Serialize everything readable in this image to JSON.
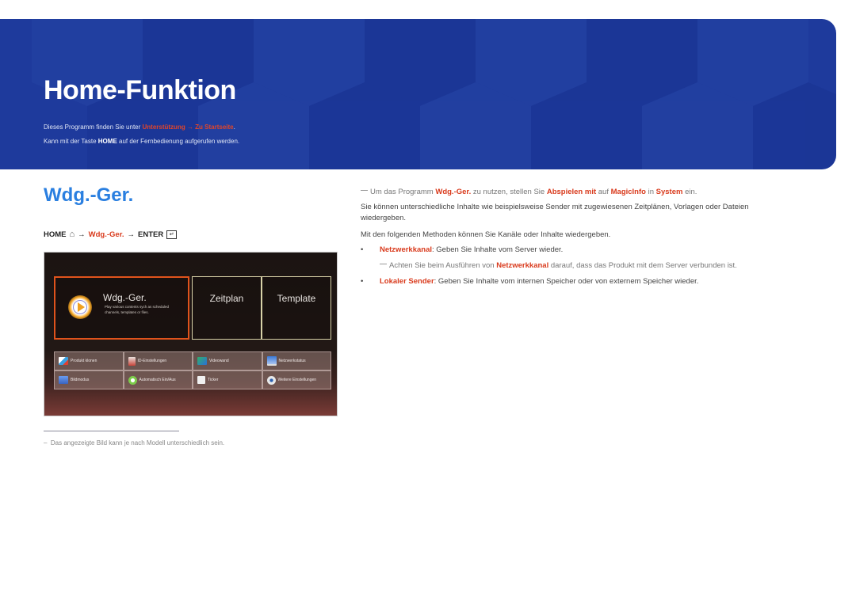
{
  "banner": {
    "title": "Home-Funktion",
    "line1_prefix": "Dieses Programm finden Sie unter ",
    "line1_path1": "Unterstützung",
    "line1_arrow": " → ",
    "line1_path2": "Zu Startseite",
    "line1_suffix": ".",
    "line2_prefix": "Kann mit der Taste ",
    "line2_key": "HOME",
    "line2_suffix": " auf der Fernbedienung aufgerufen werden.",
    "colors": {
      "background": "#1e3a9c",
      "highlight": "#e0452a"
    }
  },
  "section": {
    "title": "Wdg.-Ger.",
    "title_color": "#2a7fe0"
  },
  "nav_path": {
    "home": "HOME",
    "home_icon": "home-icon",
    "arrow1": "→",
    "item": "Wdg.-Ger.",
    "arrow2": "→",
    "enter": "ENTER",
    "enter_icon": "enter-icon"
  },
  "tv_screen": {
    "main_tile": {
      "label": "Wdg.-Ger.",
      "description": "Play various contents sych as scheduled channels, templates or files.",
      "icon": "play-icon"
    },
    "tiles": [
      {
        "label": "Zeitplan"
      },
      {
        "label": "Template"
      }
    ],
    "grid": [
      {
        "label": "Produkt klonen",
        "icon": "clone-icon"
      },
      {
        "label": "ID-Einstellungen",
        "icon": "id-icon"
      },
      {
        "label": "Videowand",
        "icon": "videowall-icon"
      },
      {
        "label": "Netzwerkstatus",
        "icon": "network-icon"
      },
      {
        "label": "Bildmodus",
        "icon": "picture-mode-icon"
      },
      {
        "label": "Automatisch Ein/Aus",
        "icon": "power-icon"
      },
      {
        "label": "Ticker",
        "icon": "ticker-icon"
      },
      {
        "label": "Weitere Einstellungen",
        "icon": "gear-icon"
      }
    ]
  },
  "footnote": "Das angezeigte Bild kann je nach Modell unterschiedlich sein.",
  "footnote_dash": "–",
  "right": {
    "note1": {
      "p1": "Um das Programm ",
      "b1": "Wdg.-Ger.",
      "p2": " zu nutzen, stellen Sie ",
      "b2": "Abspielen mit",
      "p3": " auf ",
      "b3": "MagicInfo",
      "p4": " in ",
      "b4": "System",
      "p5": " ein."
    },
    "para2": "Sie können unterschiedliche Inhalte wie beispielsweise Sender mit zugewiesenen Zeitplänen, Vorlagen oder Dateien wiedergeben.",
    "para3": "Mit den folgenden Methoden können Sie Kanäle oder Inhalte wiedergeben.",
    "bullets": [
      {
        "bullet": "•",
        "term": "Netzwerkkanal",
        "text": ": Geben Sie Inhalte vom Server wieder."
      },
      {
        "bullet": "•",
        "term": "Lokaler Sender",
        "text": ": Geben Sie Inhalte vom internen Speicher oder von externem Speicher wieder."
      }
    ],
    "subnote": {
      "p1": "Achten Sie beim Ausführen von ",
      "b1": "Netzwerkkanal",
      "p2": " darauf, dass das Produkt mit dem Server verbunden ist."
    },
    "accent_color": "#d93a1c"
  }
}
